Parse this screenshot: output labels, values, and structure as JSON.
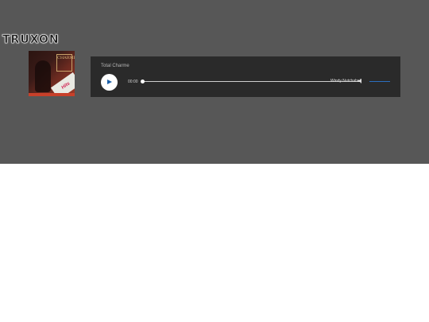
{
  "brand": {
    "logo_text": "TRUXON"
  },
  "album": {
    "cover_title": "CHARME",
    "cover_sticker": "Hits"
  },
  "player": {
    "track_title": "Total Charme",
    "time_elapsed": "00:00",
    "artist_text": "Windy Nutchahell",
    "progress_fraction": 0.0,
    "volume_fraction": 1.0,
    "colors": {
      "panel": "#2a2a2a",
      "accent": "#1a5fa8",
      "volume": "#2b6fc0"
    }
  }
}
